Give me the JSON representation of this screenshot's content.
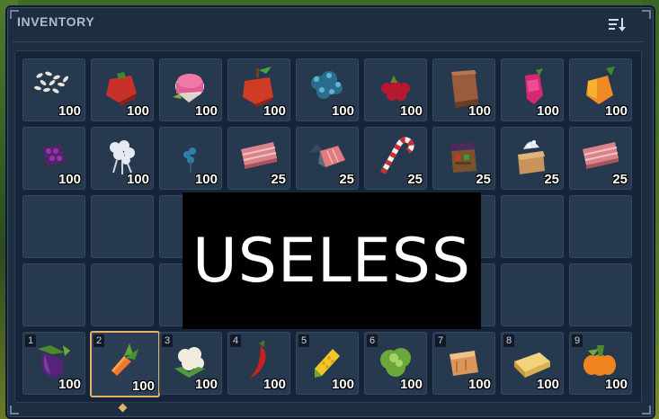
{
  "inventory": {
    "title": "INVENTORY",
    "sort_icon": "sort-icon",
    "rows": [
      [
        {
          "name": "rice",
          "qty": "100"
        },
        {
          "name": "tomato",
          "qty": "100"
        },
        {
          "name": "radish",
          "qty": "100"
        },
        {
          "name": "apple",
          "qty": "100"
        },
        {
          "name": "blue-berry-bush",
          "qty": "100"
        },
        {
          "name": "red-berries",
          "qty": "100"
        },
        {
          "name": "wood-block",
          "qty": "100"
        },
        {
          "name": "pink-berry",
          "qty": "100"
        },
        {
          "name": "orange-pepper",
          "qty": "100"
        }
      ],
      [
        {
          "name": "purple-berry",
          "qty": "100"
        },
        {
          "name": "white-flower",
          "qty": "100"
        },
        {
          "name": "blue-flower",
          "qty": "100"
        },
        {
          "name": "bacon",
          "qty": "25"
        },
        {
          "name": "fish-fillet",
          "qty": "25"
        },
        {
          "name": "candy-cane",
          "qty": "25"
        },
        {
          "name": "market-stall",
          "qty": "25"
        },
        {
          "name": "ice-box",
          "qty": "25"
        },
        {
          "name": "bacon",
          "qty": "25"
        }
      ]
    ],
    "hotbar": [
      {
        "key": "1",
        "name": "eggplant",
        "qty": "100"
      },
      {
        "key": "2",
        "name": "carrot",
        "qty": "100",
        "selected": true
      },
      {
        "key": "3",
        "name": "cauliflower",
        "qty": "100"
      },
      {
        "key": "4",
        "name": "chili-pepper",
        "qty": "100"
      },
      {
        "key": "5",
        "name": "corn",
        "qty": "100"
      },
      {
        "key": "6",
        "name": "cabbage",
        "qty": "100"
      },
      {
        "key": "7",
        "name": "bread",
        "qty": "100"
      },
      {
        "key": "8",
        "name": "cheese",
        "qty": "100"
      },
      {
        "key": "9",
        "name": "pumpkin",
        "qty": "100"
      }
    ]
  },
  "overlay_text": "USELESS",
  "colors": {
    "panel": "#1d2e41",
    "slot": "#27394f",
    "selected_border": "#e1b46a"
  }
}
